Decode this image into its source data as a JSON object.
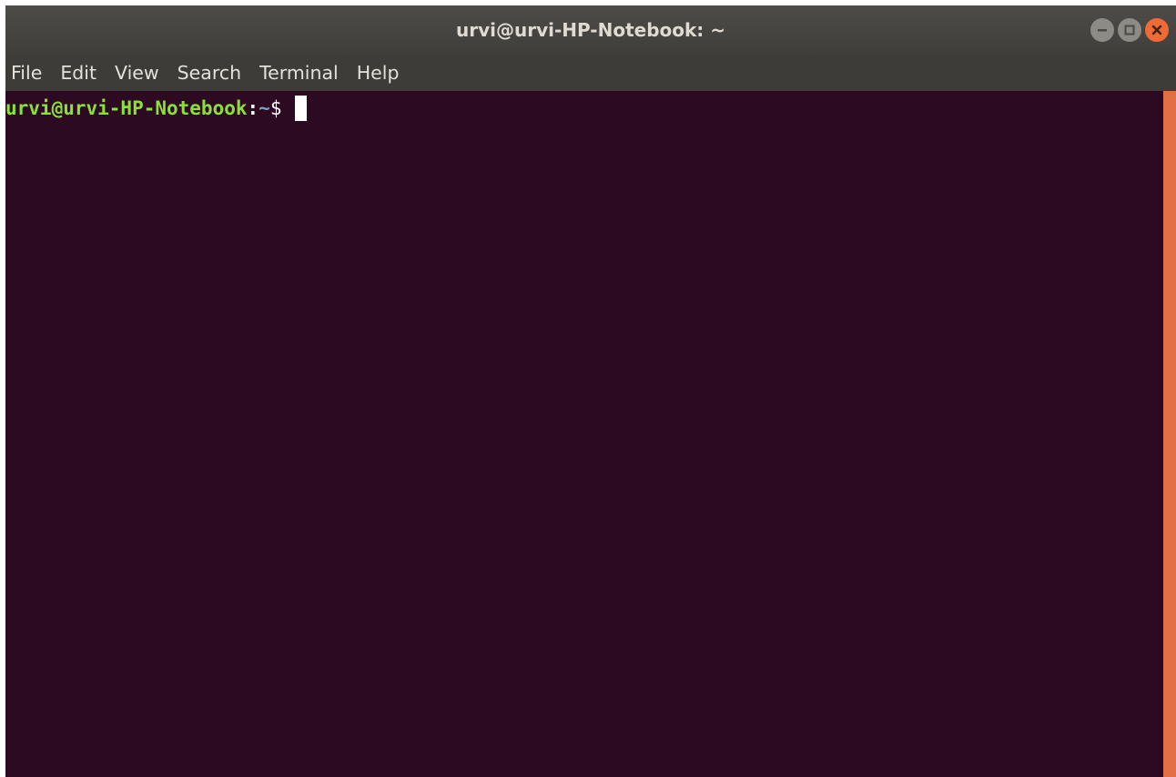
{
  "window": {
    "title": "urvi@urvi-HP-Notebook: ~"
  },
  "menu": {
    "items": [
      "File",
      "Edit",
      "View",
      "Search",
      "Terminal",
      "Help"
    ]
  },
  "terminal": {
    "prompt_user_host": "urvi@urvi-HP-Notebook",
    "prompt_colon": ":",
    "prompt_path": "~",
    "prompt_symbol": "$ ",
    "input": ""
  },
  "icons": {
    "minimize": "minimize-icon",
    "maximize": "maximize-icon",
    "close": "close-icon"
  },
  "colors": {
    "terminal_bg": "#2c0a22",
    "prompt_user": "#8ae234",
    "prompt_path": "#729fcf",
    "scrollbar_thumb": "#e36f45",
    "close_button": "#ef6a35"
  }
}
